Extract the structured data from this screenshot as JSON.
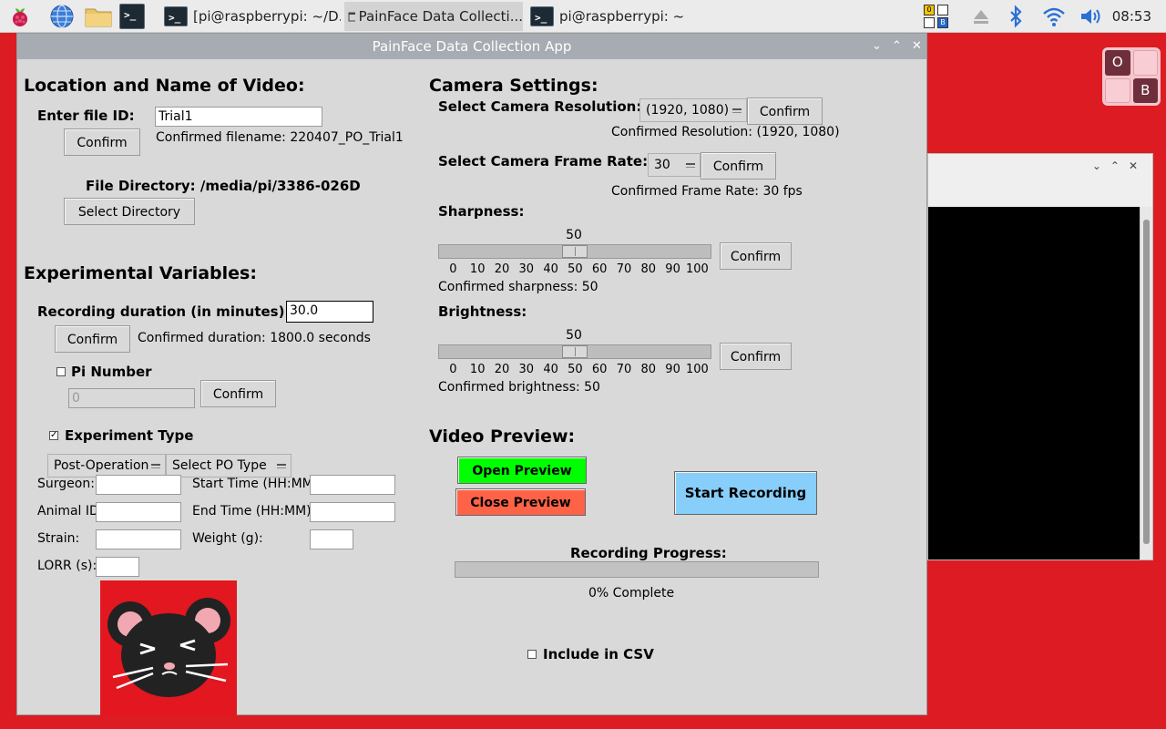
{
  "taskbar": {
    "tasks": [
      {
        "label": "[pi@raspberrypi: ~/D..."
      },
      {
        "label": "PainFace Data Collecti..."
      },
      {
        "label": "pi@raspberrypi: ~"
      }
    ],
    "terminal_glyph": ">_",
    "clock": "08:53"
  },
  "switcher": {
    "tiles": [
      "O",
      "",
      "",
      "B"
    ]
  },
  "window": {
    "title": "PainFace Data Collection App",
    "controls": [
      "⌄",
      "⌃",
      "✕"
    ]
  },
  "location": {
    "heading": "Location and Name of Video:",
    "file_id_label": "Enter file ID:",
    "file_id_value": "Trial1",
    "confirm_label": "Confirm",
    "confirmed_filename": "Confirmed filename: 220407_PO_Trial1",
    "directory_text": "File Directory: /media/pi/3386-026D",
    "select_directory_label": "Select Directory"
  },
  "experimental": {
    "heading": "Experimental Variables:",
    "duration_label": "Recording duration (in minutes):",
    "duration_value": "30.0",
    "duration_confirm": "Confirm",
    "confirmed_duration": "Confirmed duration: 1800.0 seconds",
    "pi_number_label": "Pi Number",
    "pi_number_checked": false,
    "pi_number_value": "0",
    "pi_confirm": "Confirm",
    "experiment_type_label": "Experiment Type",
    "experiment_type_checked": true,
    "type_select": "Post-Operation",
    "po_type_select": "Select PO Type",
    "fields": {
      "surgeon": "Surgeon:",
      "animal_id": "Animal ID",
      "strain": "Strain:",
      "lorr": "LORR (s):",
      "start_time": "Start Time (HH:MM",
      "end_time": "End Time (HH:MM):",
      "weight": "Weight (g):"
    }
  },
  "camera": {
    "heading": "Camera Settings:",
    "resolution_label": "Select Camera Resolution:",
    "resolution_value": "(1920, 1080)",
    "resolution_confirm": "Confirm",
    "confirmed_resolution": "Confirmed Resolution: (1920, 1080)",
    "frame_rate_label": "Select Camera Frame Rate:",
    "frame_rate_value": "30",
    "frame_rate_confirm": "Confirm",
    "confirmed_frame_rate": "Confirmed Frame Rate: 30 fps",
    "sharpness_label": "Sharpness:",
    "sharpness_value": "50",
    "sharpness_confirm": "Confirm",
    "confirmed_sharpness": "Confirmed sharpness: 50",
    "brightness_label": "Brightness:",
    "brightness_value": "50",
    "brightness_confirm": "Confirm",
    "confirmed_brightness": "Confirmed brightness: 50",
    "slider_min": 0,
    "slider_max": 100,
    "slider_ticks": [
      "0",
      "10",
      "20",
      "30",
      "40",
      "50",
      "60",
      "70",
      "80",
      "90",
      "100"
    ]
  },
  "preview": {
    "heading": "Video Preview:",
    "open_label": "Open Preview",
    "close_label": "Close Preview",
    "start_recording_label": "Start Recording",
    "progress_label": "Recording Progress:",
    "progress_fraction": 0.0,
    "progress_text": "0% Complete",
    "include_csv_label": "Include in CSV",
    "include_csv_checked": false
  },
  "colors": {
    "desktop": "#dc1c22",
    "open_preview": "#00ff00",
    "close_preview": "#ff6347",
    "start_recording": "#87cefa",
    "window_bg": "#d9d9d9"
  },
  "icons": [
    "raspberry-menu-icon",
    "web-browser-icon",
    "file-manager-icon",
    "terminal-icon",
    "eject-icon",
    "bluetooth-icon",
    "wifi-icon",
    "volume-icon",
    "mouse-logo-icon"
  ]
}
